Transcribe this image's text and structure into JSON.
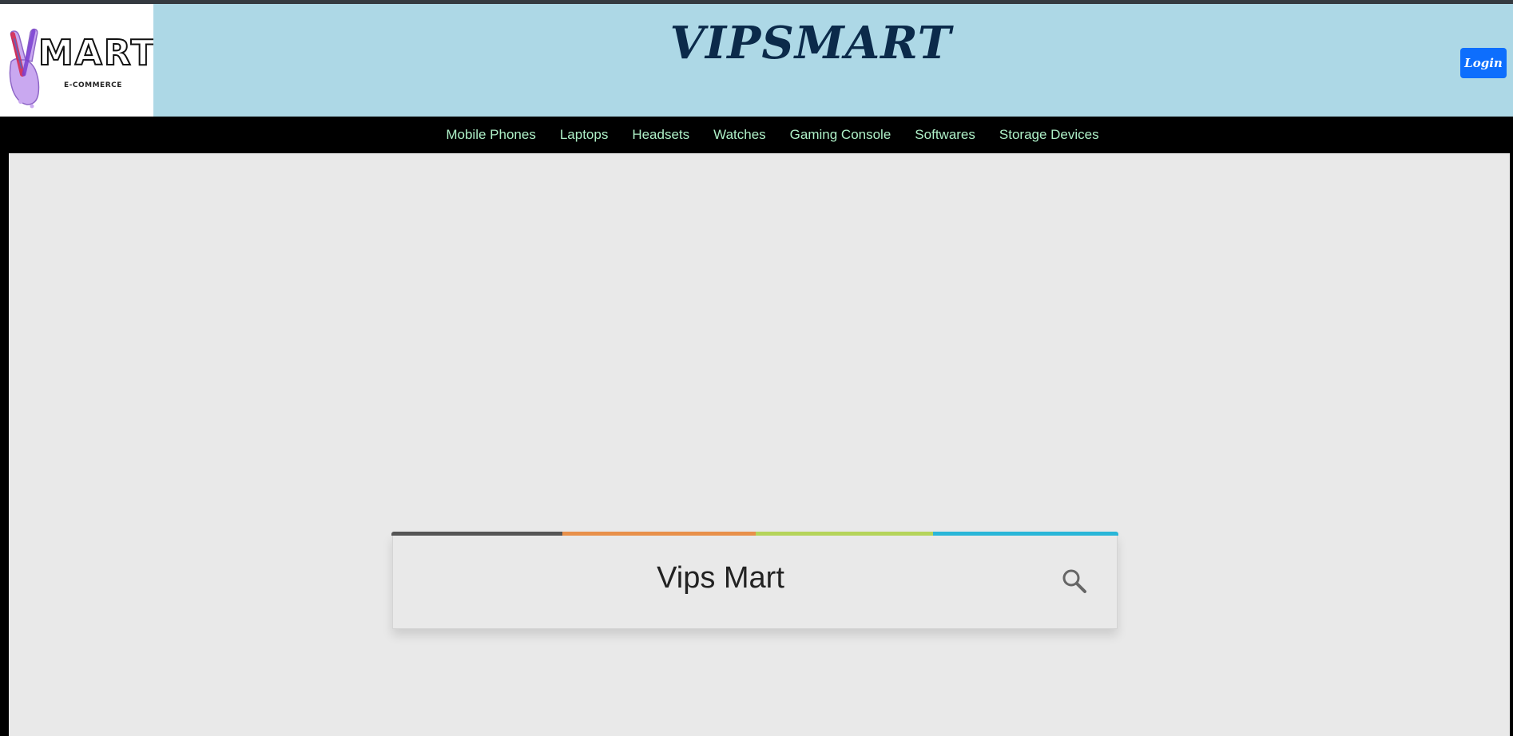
{
  "header": {
    "logo": {
      "wordmark": "MART",
      "subtitle": "E-COMMERCE"
    },
    "brand_title": "VIPSMART",
    "login_label": "Login"
  },
  "nav": {
    "items": [
      {
        "label": "Mobile Phones"
      },
      {
        "label": "Laptops"
      },
      {
        "label": "Headsets"
      },
      {
        "label": "Watches"
      },
      {
        "label": "Gaming Console"
      },
      {
        "label": "Softwares"
      },
      {
        "label": "Storage Devices"
      }
    ]
  },
  "search": {
    "value": "Vips Mart",
    "icon": "search-icon",
    "strip_colors": [
      "#555555",
      "#e8904a",
      "#b5d45a",
      "#29b6d8"
    ]
  },
  "colors": {
    "header_bg": "#add8e6",
    "brand_text": "#0b2a4a",
    "login_bg": "#0d6efd",
    "nav_bg": "#000000",
    "nav_link": "#aef0c7",
    "main_bg": "#e9e9e9"
  }
}
